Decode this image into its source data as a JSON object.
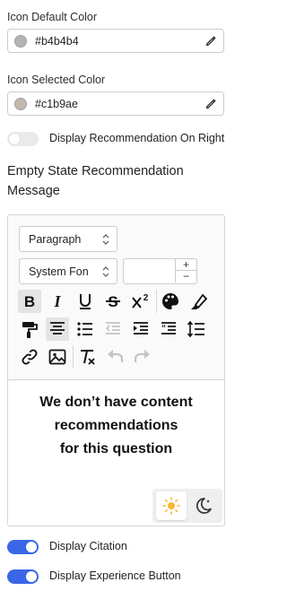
{
  "icon_default": {
    "label": "Icon Default Color",
    "value": "#b4b4b4",
    "swatch": "#b4b4b4"
  },
  "icon_selected": {
    "label": "Icon Selected Color",
    "value": "#c1b9ae",
    "swatch": "#c1b9ae"
  },
  "toggles": {
    "recommendation_right": {
      "label": "Display Recommendation On Right",
      "on": false
    },
    "citation": {
      "label": "Display Citation",
      "on": true
    },
    "experience_button": {
      "label": "Display Experience Button",
      "on": true
    }
  },
  "empty_state": {
    "title": "Empty State Recommendation Message",
    "message_lines": [
      "We don’t have content",
      "recommendations",
      "for this question"
    ]
  },
  "editor": {
    "block_format": "Paragraph",
    "font_family": "System Fon",
    "font_size": "",
    "stepper_up": "+",
    "stepper_down": "−",
    "toolbar_icons": [
      "bold-icon",
      "italic-icon",
      "underline-icon",
      "strikethrough-icon",
      "superscript-icon",
      "palette-icon",
      "highlighter-icon",
      "paint-roller-icon",
      "align-center-icon",
      "bullet-list-icon",
      "outdent-icon",
      "indent-icon",
      "blockquote-icon",
      "line-height-icon",
      "link-icon",
      "image-icon",
      "clear-format-icon",
      "undo-icon",
      "redo-icon"
    ],
    "theme_options": [
      "light-mode-icon",
      "dark-mode-icon"
    ],
    "theme_selected": "light"
  },
  "colors": {
    "accent": "#3a67e6",
    "sun": "#f5b833"
  }
}
